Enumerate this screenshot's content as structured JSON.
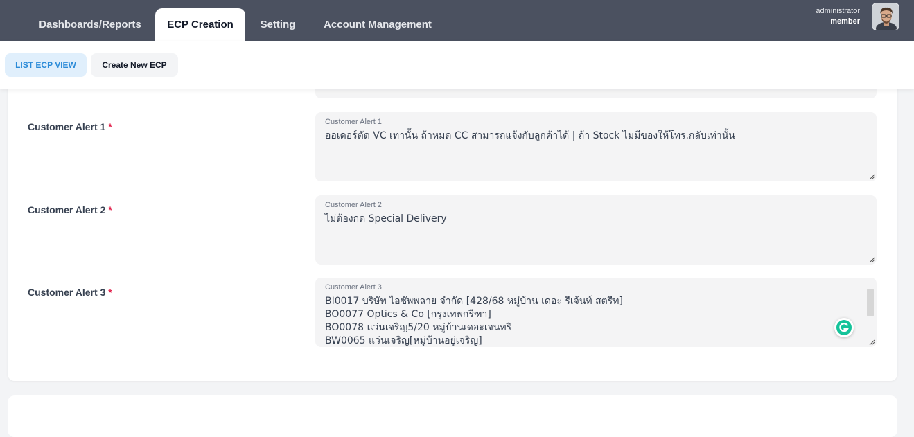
{
  "nav": {
    "tabs": [
      {
        "label": "Dashboards/Reports"
      },
      {
        "label": "ECP Creation"
      },
      {
        "label": "Setting"
      },
      {
        "label": "Account Management"
      }
    ],
    "active_tab": "ECP Creation",
    "user": {
      "name": "administrator",
      "role": "member"
    }
  },
  "subnav": {
    "list_label": "LIST ECP VIEW",
    "create_label": "Create New ECP"
  },
  "form": {
    "fields": [
      {
        "label": "Customer Alert 1",
        "caption": "Customer Alert 1",
        "value": "ออเดอร์ตัด VC เท่านั้น ถ้าหมด CC สามารถแจ้งกับลูกค้าได้ | ถ้า Stock ไม่มีของให้โทร.กลับเท่านั้น"
      },
      {
        "label": "Customer Alert 2",
        "caption": "Customer Alert 2",
        "value": "ไม่ต้องกด Special Delivery"
      },
      {
        "label": "Customer Alert 3",
        "caption": "Customer Alert 3",
        "value": "BI0017 บริษัท ไอซัพพลาย จำกัด [428/68 หมู่บ้าน เดอะ รีเจ้นท์ สตรีท]\nBO0077 Optics & Co [กรุงเทพกรีฑา]\nBO0078 แว่นเจริญ5/20 หมู่บ้านเดอะเจนทริ\nBW0065 แว่นเจริญ[หมู่บ้านอยู่เจริญ]"
      }
    ],
    "required_mark": "*"
  },
  "colors": {
    "topbar": "#4b5160",
    "accent": "#2b8bd8",
    "required": "#e11d48",
    "grammarly": "#15c39a"
  },
  "icons": [
    "avatar",
    "grammarly-icon",
    "resize-grip-icon"
  ]
}
